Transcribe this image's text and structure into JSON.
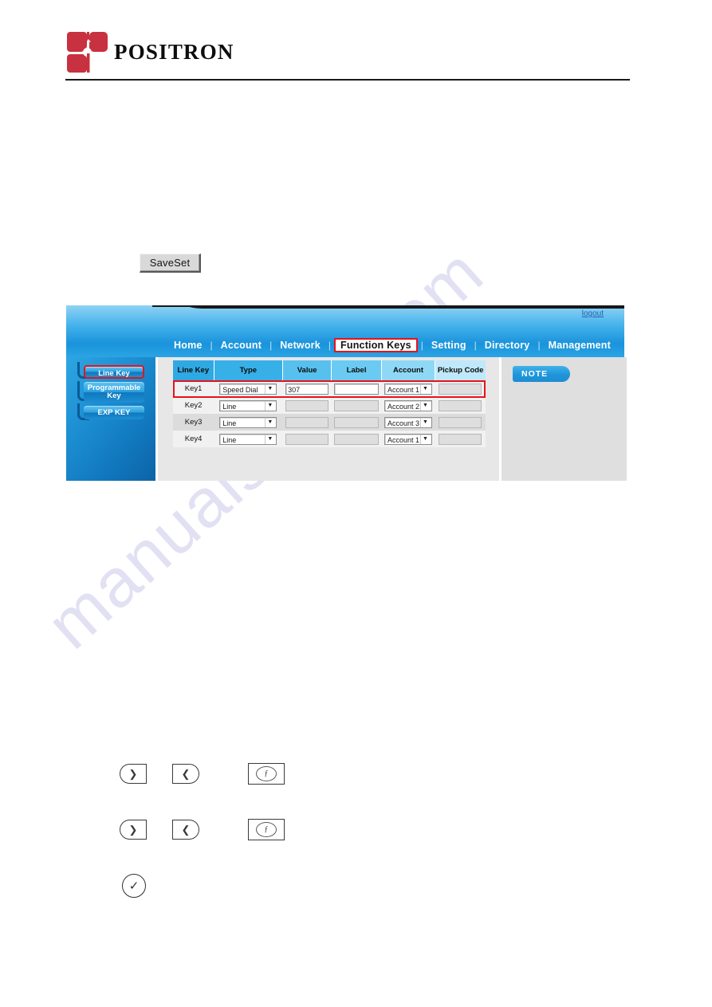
{
  "letterhead": {
    "brand": "POSITRON",
    "logo_color": "#c8313f"
  },
  "saveset": {
    "label": "SaveSet"
  },
  "watermark": {
    "text": "manualshive.com",
    "color": "#c9c9ea"
  },
  "phone_ui": {
    "logout_label": "logout",
    "nav": {
      "items": [
        {
          "label": "Home",
          "active": false
        },
        {
          "label": "Account",
          "active": false
        },
        {
          "label": "Network",
          "active": false
        },
        {
          "label": "Function Keys",
          "active": true
        },
        {
          "label": "Setting",
          "active": false
        },
        {
          "label": "Directory",
          "active": false
        },
        {
          "label": "Management",
          "active": false
        }
      ],
      "separator": "|",
      "active_outline_color": "#e8121b"
    },
    "sidebar": {
      "items": [
        {
          "label": "Line Key",
          "highlighted": true
        },
        {
          "label": "Programmable Key",
          "highlighted": false
        },
        {
          "label": "EXP KEY",
          "highlighted": false
        }
      ]
    },
    "table": {
      "headers": [
        "Line Key",
        "Type",
        "Value",
        "Label",
        "Account",
        "Pickup Code"
      ],
      "rows": [
        {
          "key": "Key1",
          "type": "Speed Dial",
          "value": "307",
          "label": "",
          "account": "Account 1",
          "pickup_code": "",
          "enabled": true,
          "highlighted": true
        },
        {
          "key": "Key2",
          "type": "Line",
          "value": "",
          "label": "",
          "account": "Account 2",
          "pickup_code": "",
          "enabled": false,
          "highlighted": false
        },
        {
          "key": "Key3",
          "type": "Line",
          "value": "",
          "label": "",
          "account": "Account 3",
          "pickup_code": "",
          "enabled": false,
          "highlighted": false
        },
        {
          "key": "Key4",
          "type": "Line",
          "value": "",
          "label": "",
          "account": "Account 1",
          "pickup_code": "",
          "enabled": false,
          "highlighted": false
        }
      ]
    },
    "note": {
      "tab_label": "NOTE",
      "body": ""
    }
  },
  "key_glyphs": {
    "right_arrow": "❯",
    "left_arrow": "❮",
    "ok_symbol": "ƒ",
    "check_symbol": "✓",
    "rows": [
      {
        "icons": [
          "right-arrow-key-icon",
          "left-arrow-key-icon",
          "ok-key-icon"
        ]
      },
      {
        "icons": [
          "right-arrow-key-icon",
          "left-arrow-key-icon",
          "ok-key-icon"
        ]
      }
    ],
    "check_row": {
      "icons": [
        "check-key-icon"
      ]
    }
  }
}
